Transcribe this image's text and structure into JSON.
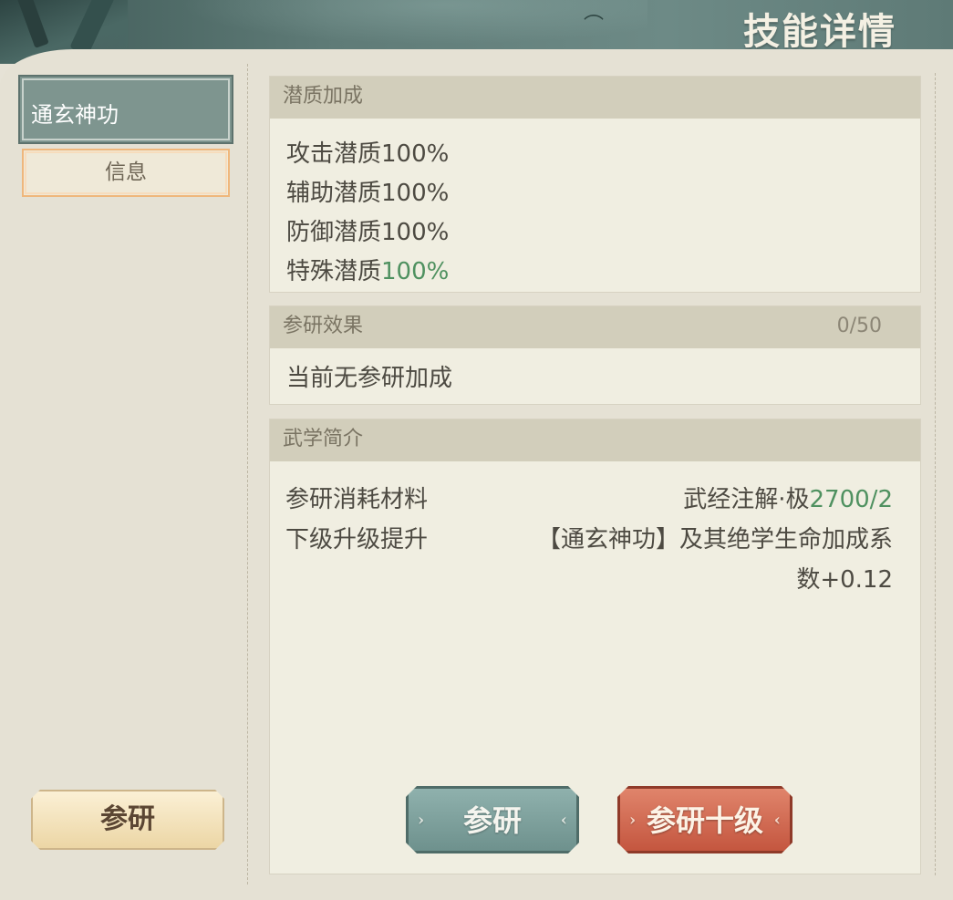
{
  "header": {
    "title": "技能详情"
  },
  "left": {
    "skill_tab": "通玄神功",
    "info_tab": "信息",
    "canyan_button": "参研"
  },
  "sections": {
    "potential": {
      "title": "潜质加成",
      "lines": [
        {
          "label": "攻击潜质",
          "value": "100%"
        },
        {
          "label": "辅助潜质",
          "value": "100%"
        },
        {
          "label": "防御潜质",
          "value": "100%"
        },
        {
          "label": "特殊潜质",
          "value": "100%"
        }
      ]
    },
    "research": {
      "title": "参研效果",
      "count": "0/50",
      "text": "当前无参研加成"
    },
    "intro": {
      "title": "武学简介",
      "cost_label": "参研消耗材料",
      "cost_item": "武经注解·极",
      "cost_value": "2700/2",
      "upgrade_label": "下级升级提升",
      "upgrade_text_1": "【通玄神功】及其绝学生命加成系",
      "upgrade_text_2": "数+0.12"
    }
  },
  "buttons": {
    "canyan": "参研",
    "canyan_ten": "参研十级"
  },
  "colors": {
    "header": "#5f7b77",
    "accent_green": "#4f9160",
    "button_red": "#c4563f",
    "button_teal": "#6e918d"
  }
}
